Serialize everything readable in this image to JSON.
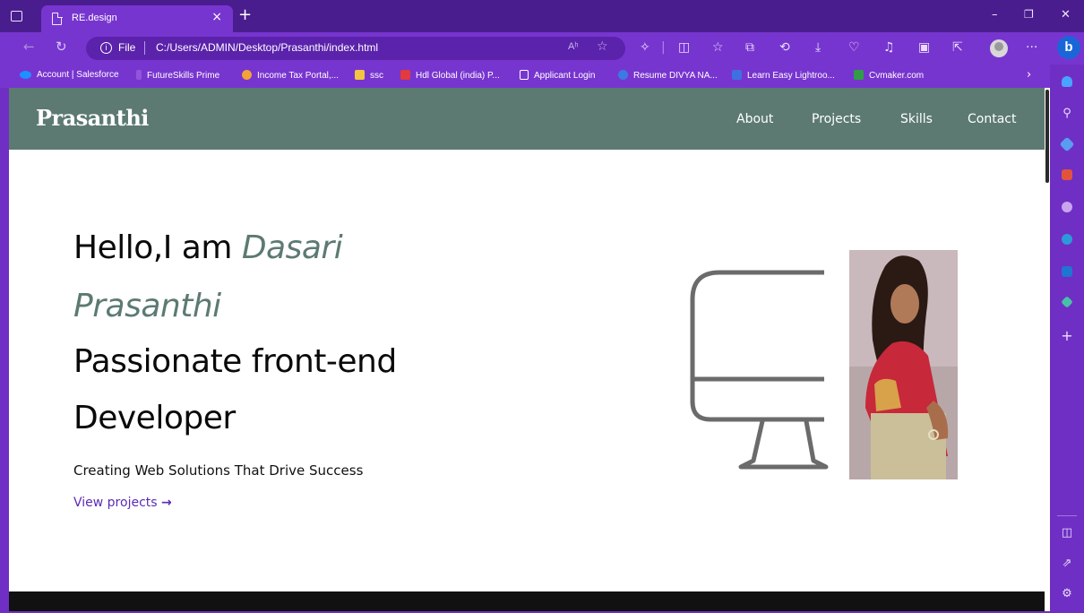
{
  "browser": {
    "tab_title": "RE.design",
    "tab_close": "×",
    "new_tab": "+",
    "window_controls": {
      "minimize": "–",
      "restore": "❐",
      "close": "✕"
    },
    "address": {
      "scheme_label": "File",
      "url": "C:/Users/ADMIN/Desktop/Prasanthi/index.html",
      "read_aloud": "Aʰ",
      "favorite": "☆"
    },
    "more_menu": "···",
    "bookmarks": [
      {
        "label": "Account | Salesforce",
        "color": "#1e90ff"
      },
      {
        "label": "FutureSkills Prime",
        "color": "#7735cf"
      },
      {
        "label": "Income Tax Portal,...",
        "color": "#f2a33a"
      },
      {
        "label": "ssc",
        "color": "#f2c640"
      },
      {
        "label": "Hdl Global (india) P...",
        "color": "#e23b3b"
      },
      {
        "label": "Applicant Login",
        "color": "#ffffff"
      },
      {
        "label": "Resume DIVYA NA...",
        "color": "#3b7ae2"
      },
      {
        "label": "Learn Easy Lightroo...",
        "color": "#3f6fe0"
      },
      {
        "label": "Cvmaker.com",
        "color": "#2f9e44"
      }
    ],
    "bookmarks_more": "›"
  },
  "site": {
    "logo": "Prasanthi",
    "nav": [
      "About",
      "Projects",
      "Skills",
      "Contact"
    ],
    "hero": {
      "greeting": "Hello,I am ",
      "name_part1": "Dasari",
      "name_part2": "Prasanthi",
      "role_line1": "Passionate front-end",
      "role_line2": "Developer",
      "subtitle": "Creating Web Solutions That Drive Success",
      "cta_label": "View projects ",
      "cta_arrow": "→"
    }
  },
  "colors": {
    "header_bg": "#5c7a72",
    "accent": "#5c7a72",
    "link": "#5b2bb3",
    "browser_chrome": "#7735cf",
    "titlebar": "#4a1d8f"
  }
}
